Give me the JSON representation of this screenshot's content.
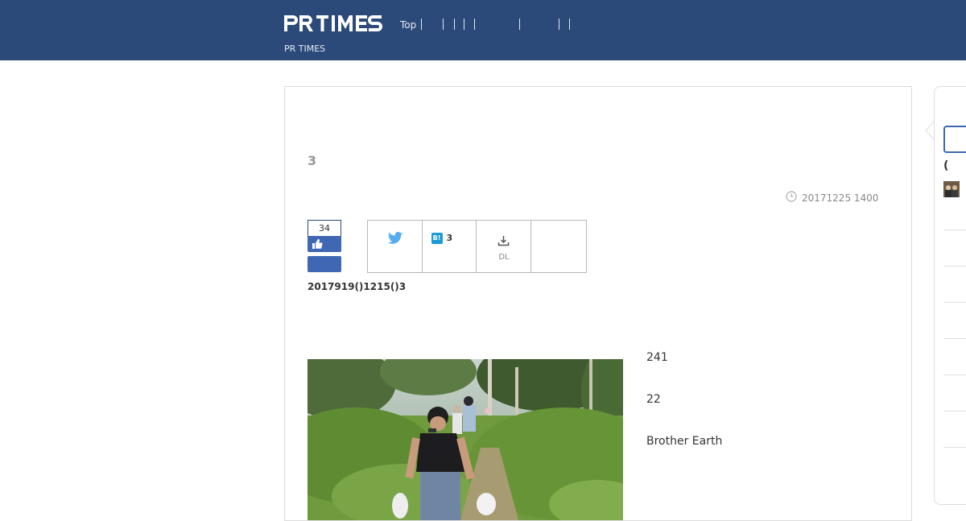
{
  "header": {
    "brand": "PR TIMES",
    "tagline": "PR TIMES",
    "nav": [
      {
        "label": "Top"
      }
    ]
  },
  "article": {
    "company": "3",
    "published": "20171225 1400",
    "likes": "34",
    "subtitle": "2017919()1215()3",
    "stats": [
      "241",
      "22",
      "Brother Earth"
    ]
  },
  "share": {
    "hatena_label": "B!",
    "hatena_count": "3",
    "download_label": "DL"
  },
  "sidebar": {
    "paren_text": "("
  },
  "colors": {
    "header_bg": "#2b4a7a",
    "accent": "#3f67b3",
    "twitter": "#55acee",
    "hatena": "#1a9bd7"
  }
}
